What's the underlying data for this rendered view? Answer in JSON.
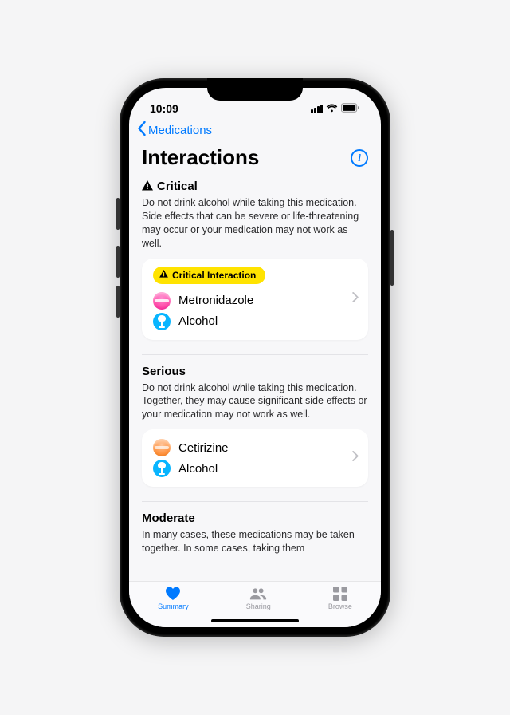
{
  "status": {
    "time": "10:09"
  },
  "nav": {
    "back": "Medications"
  },
  "page": {
    "title": "Interactions"
  },
  "sections": [
    {
      "name": "Critical",
      "icon": "warning",
      "desc": "Do not drink alcohol while taking this medication. Side effects that can be severe or life-threatening may occur or your medication may not work as well.",
      "card": {
        "badge": "Critical Interaction",
        "items": [
          {
            "label": "Metronidazole",
            "icon": "pill-pink"
          },
          {
            "label": "Alcohol",
            "icon": "wine-blue"
          }
        ]
      }
    },
    {
      "name": "Serious",
      "desc": "Do not drink alcohol while taking this medication. Together, they may cause significant side effects or your medication may not work as well.",
      "card": {
        "items": [
          {
            "label": "Cetirizine",
            "icon": "pill-orange"
          },
          {
            "label": "Alcohol",
            "icon": "wine-blue"
          }
        ]
      }
    },
    {
      "name": "Moderate",
      "desc": "In many cases, these medications may be taken together. In some cases, taking them"
    }
  ],
  "tabs": [
    {
      "label": "Summary",
      "icon": "heart",
      "active": true
    },
    {
      "label": "Sharing",
      "icon": "people",
      "active": false
    },
    {
      "label": "Browse",
      "icon": "grid",
      "active": false
    }
  ]
}
